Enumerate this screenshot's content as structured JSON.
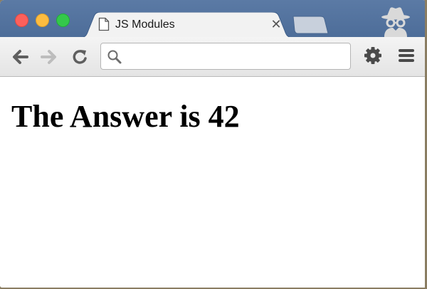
{
  "window": {
    "controls": [
      "close-button",
      "minimize-button",
      "maximize-button"
    ],
    "incognito_icon": "incognito-icon"
  },
  "tabs": [
    {
      "title": "JS Modules",
      "icon": "document-icon",
      "close_label": "✕",
      "active": true
    }
  ],
  "toolbar": {
    "back_icon": "arrow-left-icon",
    "forward_icon": "arrow-right-icon",
    "reload_icon": "reload-icon",
    "omnibox": {
      "value": "",
      "placeholder": "",
      "icon": "search-icon"
    },
    "settings_icon": "gear-icon",
    "menu_icon": "hamburger-icon"
  },
  "page": {
    "heading": "The Answer is 42"
  },
  "colors": {
    "tabstrip": "#5b7aa5",
    "close": "#fc605b",
    "minimize": "#fdbc40",
    "maximize": "#34c84a"
  }
}
